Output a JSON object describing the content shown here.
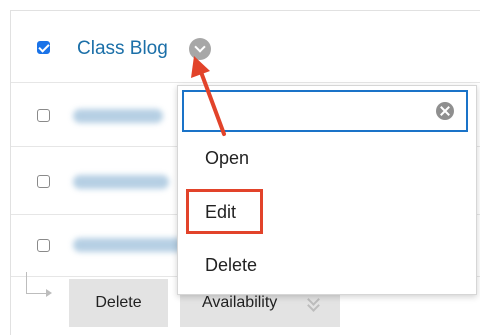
{
  "rows": [
    {
      "title": "Class Blog",
      "checked": true
    },
    {
      "title": "",
      "checked": false
    },
    {
      "title": "",
      "checked": false
    },
    {
      "title": "",
      "checked": false
    }
  ],
  "dropdown": {
    "search_value": "",
    "items": [
      "Open",
      "Edit",
      "Delete"
    ]
  },
  "footer": {
    "delete_label": "Delete",
    "availability_label": "Availability"
  },
  "icons": {
    "row_menu": "chevron-down-icon",
    "clear": "clear-icon",
    "footer_chevron": "chevron-down-icon"
  },
  "colors": {
    "link": "#1b6fa8",
    "checkbox": "#1a73e8",
    "annotation": "#e2432a",
    "search_border": "#1a73c8"
  }
}
